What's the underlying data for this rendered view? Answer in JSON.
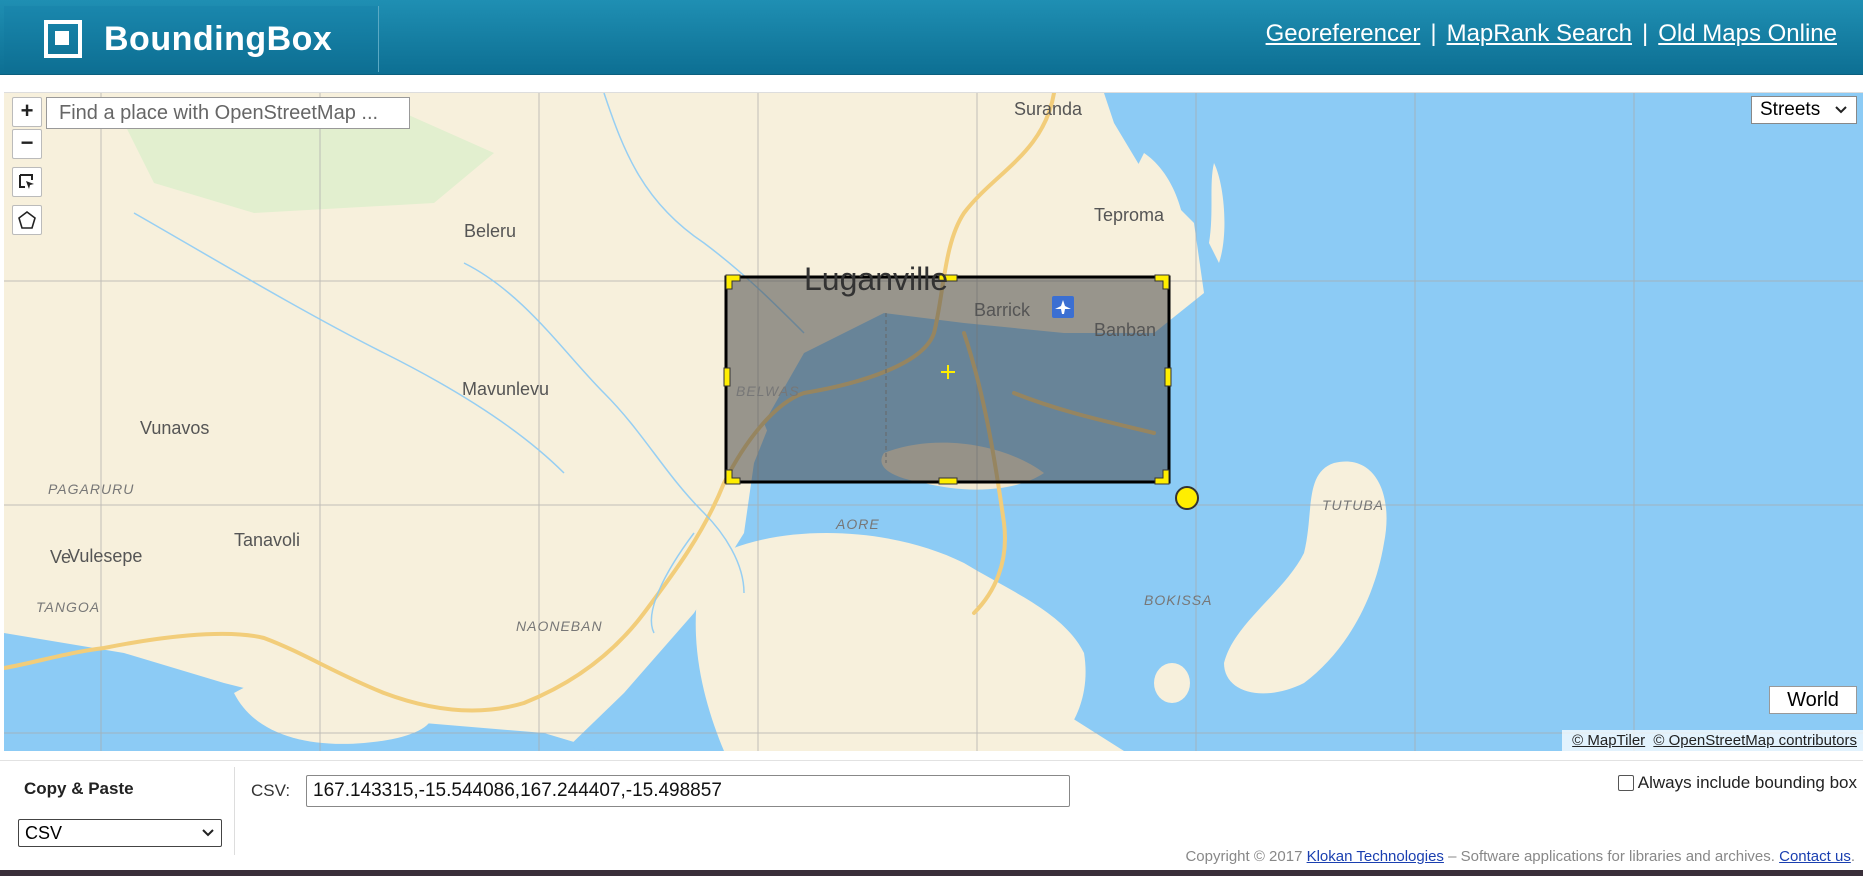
{
  "header": {
    "brand": "BoundingBox",
    "links": [
      "Georeferencer",
      "MapRank Search",
      "Old Maps Online"
    ],
    "separator": "|"
  },
  "map": {
    "search_placeholder": "Find a place with OpenStreetMap ...",
    "zoom_in": "+",
    "zoom_out": "−",
    "layer": "Streets",
    "world_button": "World",
    "attribution": [
      "© MapTiler",
      "© OpenStreetMap contributors"
    ],
    "places": {
      "suranda": "Suranda",
      "teproma": "Teproma",
      "beleru": "Beleru",
      "luganville": "Luganville",
      "barrick": "Barrick",
      "banban": "Banban",
      "mavunlevu": "Mavunlevu",
      "belwas": "BELWAS",
      "vunavos": "Vunavos",
      "pagaruru": "PAGARURU",
      "tanavoli": "Tanavoli",
      "vulesepe": "Vulesepe",
      "ve": "Ve",
      "tangoa": "TANGOA",
      "naoneban": "NAONEBAN",
      "aore": "AORE",
      "tutuba": "TUTUBA",
      "bokissa": "BOKISSA"
    },
    "colors": {
      "land": "#f7f0dc",
      "water": "#8ccbf5",
      "selection": "#4a4a4a",
      "handle": "#ffee00"
    },
    "icons": [
      "airport-icon",
      "crosshair-icon",
      "select-box-icon",
      "polygon-icon"
    ]
  },
  "panel": {
    "title": "Copy & Paste",
    "format": "CSV",
    "csv_label": "CSV:",
    "csv_value": "167.143315,-15.544086,167.244407,-15.498857",
    "always_label": "Always include bounding box"
  },
  "footer": {
    "prefix": "Copyright © 2017",
    "company": "Klokan Technologies",
    "middle": "– Software applications for libraries and archives.",
    "contact": "Contact us",
    "end": "."
  }
}
